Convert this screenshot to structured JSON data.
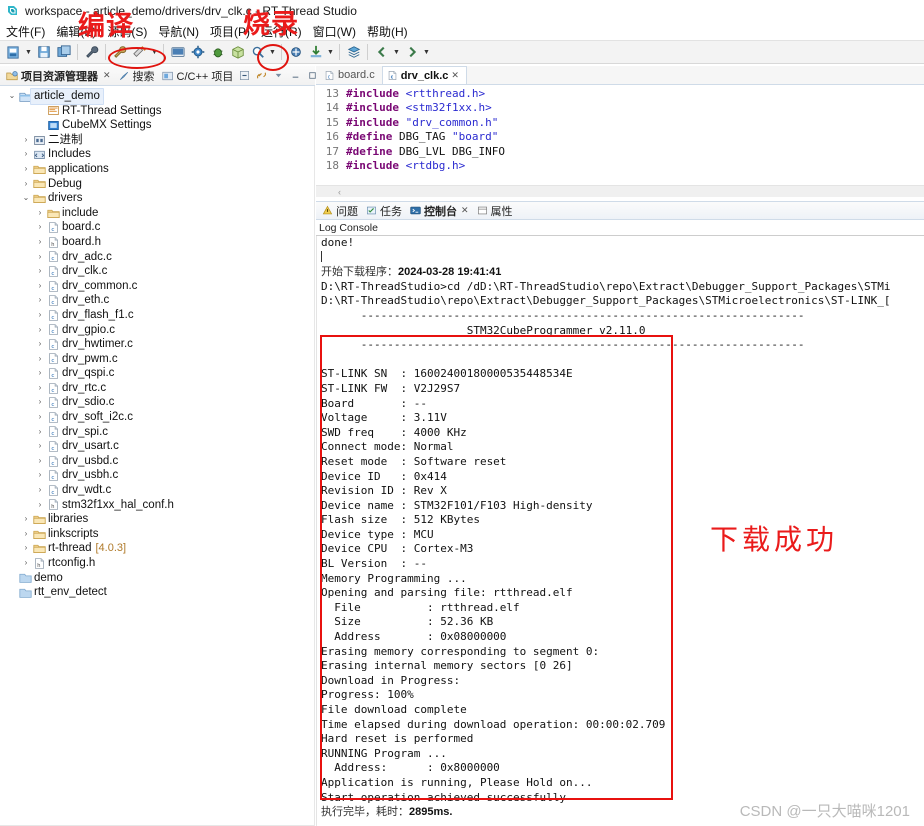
{
  "window": {
    "title": "workspace - article_demo/drivers/drv_clk.c - RT-Thread Studio",
    "app_icon": "rt-thread-logo-icon"
  },
  "menubar": {
    "items": [
      {
        "label": "文件(F)",
        "name": "menu-file"
      },
      {
        "label": "编辑(E)",
        "name": "menu-edit"
      },
      {
        "label": "源码(S)",
        "name": "menu-source"
      },
      {
        "label": "导航(N)",
        "name": "menu-navigate"
      },
      {
        "label": "项目(P)",
        "name": "menu-project"
      },
      {
        "label": "运行(R)",
        "name": "menu-run"
      },
      {
        "label": "窗口(W)",
        "name": "menu-window"
      },
      {
        "label": "帮助(H)",
        "name": "menu-help"
      }
    ]
  },
  "toolbar": {
    "buttons": [
      {
        "name": "new-icon",
        "glyph": "new"
      },
      {
        "name": "new-dropdown-arrow-icon",
        "glyph": "arrow"
      },
      {
        "name": "save-icon",
        "glyph": "save"
      },
      {
        "name": "save-all-icon",
        "glyph": "saveall"
      },
      {
        "name": "sep1",
        "glyph": "sep"
      },
      {
        "name": "wrench-icon",
        "glyph": "wrench"
      },
      {
        "name": "sep2",
        "glyph": "sep"
      },
      {
        "name": "build-icon",
        "glyph": "build"
      },
      {
        "name": "clean-icon",
        "glyph": "clean"
      },
      {
        "name": "build-dropdown-arrow-icon",
        "glyph": "arrow"
      },
      {
        "name": "sep3",
        "glyph": "sep"
      },
      {
        "name": "terminal-icon",
        "glyph": "terminal"
      },
      {
        "name": "settings-gear-icon",
        "glyph": "gear"
      },
      {
        "name": "debug-bug-icon",
        "glyph": "bug"
      },
      {
        "name": "package-icon",
        "glyph": "package"
      },
      {
        "name": "search-icon",
        "glyph": "search"
      },
      {
        "name": "search-dropdown-arrow-icon",
        "glyph": "arrow"
      },
      {
        "name": "sep4",
        "glyph": "sep"
      },
      {
        "name": "flash-icon",
        "glyph": "flash"
      },
      {
        "name": "download-icon",
        "glyph": "download"
      },
      {
        "name": "download-dropdown-arrow-icon",
        "glyph": "arrow"
      },
      {
        "name": "sep5",
        "glyph": "sep"
      },
      {
        "name": "layers-icon",
        "glyph": "layers"
      },
      {
        "name": "sep6",
        "glyph": "sep"
      },
      {
        "name": "back-icon",
        "glyph": "back"
      },
      {
        "name": "back-dropdown-arrow-icon",
        "glyph": "arrow"
      },
      {
        "name": "forward-icon",
        "glyph": "forward"
      },
      {
        "name": "forward-dropdown-arrow-icon",
        "glyph": "arrow"
      }
    ]
  },
  "annotations": {
    "compile": "编译",
    "flash": "烧录",
    "download_success": "下载成功",
    "box_color": "#e8110f",
    "text_color": "#ea1b1b"
  },
  "watermark": "CSDN @一只大喵咪1201",
  "left_panel": {
    "tabs": [
      {
        "label": "项目资源管理器",
        "name": "tab-project-explorer",
        "active": true,
        "icon": "project-explorer-icon",
        "closable": true
      },
      {
        "label": "搜索",
        "name": "tab-search",
        "active": false,
        "icon": "search-view-icon",
        "closable": false
      },
      {
        "label": "C/C++ 项目",
        "name": "tab-cpp-projects",
        "active": false,
        "icon": "cpp-projects-icon",
        "closable": false
      }
    ],
    "view_tools": [
      {
        "name": "collapse-all-icon"
      },
      {
        "name": "link-with-editor-icon"
      },
      {
        "name": "view-menu-icon"
      },
      {
        "name": "minimize-icon"
      },
      {
        "name": "maximize-icon"
      }
    ],
    "tree": [
      {
        "label": "article_demo",
        "indent": 0,
        "twist": "open",
        "icon": "project",
        "selected": true
      },
      {
        "label": "RT-Thread Settings",
        "indent": 2,
        "twist": "none",
        "icon": "rtt-settings"
      },
      {
        "label": "CubeMX Settings",
        "indent": 2,
        "twist": "none",
        "icon": "cubemx-settings"
      },
      {
        "label": "二进制",
        "indent": 1,
        "twist": "closed",
        "icon": "binaries"
      },
      {
        "label": "Includes",
        "indent": 1,
        "twist": "closed",
        "icon": "includes"
      },
      {
        "label": "applications",
        "indent": 1,
        "twist": "closed",
        "icon": "folder"
      },
      {
        "label": "Debug",
        "indent": 1,
        "twist": "closed",
        "icon": "folder"
      },
      {
        "label": "drivers",
        "indent": 1,
        "twist": "open",
        "icon": "folder"
      },
      {
        "label": "include",
        "indent": 2,
        "twist": "closed",
        "icon": "folder"
      },
      {
        "label": "board.c",
        "indent": 2,
        "twist": "closed",
        "icon": "c-file"
      },
      {
        "label": "board.h",
        "indent": 2,
        "twist": "closed",
        "icon": "h-file"
      },
      {
        "label": "drv_adc.c",
        "indent": 2,
        "twist": "closed",
        "icon": "c-file"
      },
      {
        "label": "drv_clk.c",
        "indent": 2,
        "twist": "closed",
        "icon": "c-file"
      },
      {
        "label": "drv_common.c",
        "indent": 2,
        "twist": "closed",
        "icon": "c-file"
      },
      {
        "label": "drv_eth.c",
        "indent": 2,
        "twist": "closed",
        "icon": "c-file"
      },
      {
        "label": "drv_flash_f1.c",
        "indent": 2,
        "twist": "closed",
        "icon": "c-file"
      },
      {
        "label": "drv_gpio.c",
        "indent": 2,
        "twist": "closed",
        "icon": "c-file"
      },
      {
        "label": "drv_hwtimer.c",
        "indent": 2,
        "twist": "closed",
        "icon": "c-file"
      },
      {
        "label": "drv_pwm.c",
        "indent": 2,
        "twist": "closed",
        "icon": "c-file"
      },
      {
        "label": "drv_qspi.c",
        "indent": 2,
        "twist": "closed",
        "icon": "c-file"
      },
      {
        "label": "drv_rtc.c",
        "indent": 2,
        "twist": "closed",
        "icon": "c-file"
      },
      {
        "label": "drv_sdio.c",
        "indent": 2,
        "twist": "closed",
        "icon": "c-file"
      },
      {
        "label": "drv_soft_i2c.c",
        "indent": 2,
        "twist": "closed",
        "icon": "c-file"
      },
      {
        "label": "drv_spi.c",
        "indent": 2,
        "twist": "closed",
        "icon": "c-file"
      },
      {
        "label": "drv_usart.c",
        "indent": 2,
        "twist": "closed",
        "icon": "c-file"
      },
      {
        "label": "drv_usbd.c",
        "indent": 2,
        "twist": "closed",
        "icon": "c-file"
      },
      {
        "label": "drv_usbh.c",
        "indent": 2,
        "twist": "closed",
        "icon": "c-file"
      },
      {
        "label": "drv_wdt.c",
        "indent": 2,
        "twist": "closed",
        "icon": "c-file"
      },
      {
        "label": "stm32f1xx_hal_conf.h",
        "indent": 2,
        "twist": "closed",
        "icon": "h-file"
      },
      {
        "label": "libraries",
        "indent": 1,
        "twist": "closed",
        "icon": "folder"
      },
      {
        "label": "linkscripts",
        "indent": 1,
        "twist": "closed",
        "icon": "folder"
      },
      {
        "label": "rt-thread",
        "indent": 1,
        "twist": "closed",
        "icon": "folder",
        "version": "[4.0.3]"
      },
      {
        "label": "rtconfig.h",
        "indent": 1,
        "twist": "closed",
        "icon": "h-file"
      },
      {
        "label": "demo",
        "indent": 0,
        "twist": "none",
        "icon": "closed-project"
      },
      {
        "label": "rtt_env_detect",
        "indent": 0,
        "twist": "none",
        "icon": "closed-project"
      }
    ]
  },
  "editor": {
    "tabs": [
      {
        "label": "board.c",
        "name": "editor-tab-board-c",
        "active": false,
        "icon": "c-file-icon",
        "closable": false
      },
      {
        "label": "drv_clk.c",
        "name": "editor-tab-drv-clk-c",
        "active": true,
        "icon": "c-file-icon",
        "closable": true
      }
    ],
    "lines": [
      {
        "no": "13",
        "parts": [
          {
            "t": "#include ",
            "c": "pre"
          },
          {
            "t": "<rtthread.h>",
            "c": "inc"
          }
        ]
      },
      {
        "no": "14",
        "parts": [
          {
            "t": "#include ",
            "c": "pre"
          },
          {
            "t": "<stm32f1xx.h>",
            "c": "inc"
          }
        ]
      },
      {
        "no": "15",
        "parts": [
          {
            "t": "#include ",
            "c": "pre"
          },
          {
            "t": "\"drv_common.h\"",
            "c": "str"
          }
        ]
      },
      {
        "no": "16",
        "parts": [
          {
            "t": "#define ",
            "c": "pre"
          },
          {
            "t": "DBG_TAG ",
            "c": "plain"
          },
          {
            "t": "\"board\"",
            "c": "str"
          }
        ]
      },
      {
        "no": "17",
        "parts": [
          {
            "t": "#define ",
            "c": "pre"
          },
          {
            "t": "DBG_LVL DBG_INFO",
            "c": "plain"
          }
        ]
      },
      {
        "no": "18",
        "parts": [
          {
            "t": "#include ",
            "c": "pre"
          },
          {
            "t": "<rtdbg.h>",
            "c": "inc"
          }
        ]
      }
    ],
    "hscroll_glyph": "‹"
  },
  "console": {
    "tabs": [
      {
        "label": "问题",
        "name": "tab-problems",
        "active": false,
        "icon": "problems-icon",
        "closable": false
      },
      {
        "label": "任务",
        "name": "tab-tasks",
        "active": false,
        "icon": "tasks-icon",
        "closable": false
      },
      {
        "label": "控制台",
        "name": "tab-console",
        "active": true,
        "icon": "console-icon",
        "closable": true
      },
      {
        "label": "属性",
        "name": "tab-properties",
        "active": false,
        "icon": "properties-icon",
        "closable": false
      }
    ],
    "title": "Log Console",
    "lines": [
      {
        "text": "done!",
        "style": "mono"
      },
      {
        "text": "",
        "style": "caret"
      },
      {
        "text": "开始下载程序：",
        "bold": "2024-03-28 19:41:41",
        "style": "ui"
      },
      {
        "text": "D:\\RT-ThreadStudio>cd /dD:\\RT-ThreadStudio\\repo\\Extract\\Debugger_Support_Packages\\STMi",
        "style": "mono"
      },
      {
        "text": "D:\\RT-ThreadStudio\\repo\\Extract\\Debugger_Support_Packages\\STMicroelectronics\\ST-LINK_[",
        "style": "mono"
      },
      {
        "text": "      -------------------------------------------------------------------",
        "style": "mono"
      },
      {
        "text": "                      STM32CubeProgrammer v2.11.0",
        "style": "mono"
      },
      {
        "text": "      -------------------------------------------------------------------",
        "style": "mono"
      },
      {
        "text": "",
        "style": "mono"
      },
      {
        "text": "ST-LINK SN  : 16002400180000535448534E",
        "style": "mono"
      },
      {
        "text": "ST-LINK FW  : V2J29S7",
        "style": "mono"
      },
      {
        "text": "Board       : --",
        "style": "mono"
      },
      {
        "text": "Voltage     : 3.11V",
        "style": "mono"
      },
      {
        "text": "SWD freq    : 4000 KHz",
        "style": "mono"
      },
      {
        "text": "Connect mode: Normal",
        "style": "mono"
      },
      {
        "text": "Reset mode  : Software reset",
        "style": "mono"
      },
      {
        "text": "Device ID   : 0x414",
        "style": "mono"
      },
      {
        "text": "Revision ID : Rev X",
        "style": "mono"
      },
      {
        "text": "Device name : STM32F101/F103 High-density",
        "style": "mono"
      },
      {
        "text": "Flash size  : 512 KBytes",
        "style": "mono"
      },
      {
        "text": "Device type : MCU",
        "style": "mono"
      },
      {
        "text": "Device CPU  : Cortex-M3",
        "style": "mono"
      },
      {
        "text": "BL Version  : --",
        "style": "mono"
      },
      {
        "text": "Memory Programming ...",
        "style": "mono"
      },
      {
        "text": "Opening and parsing file: rtthread.elf",
        "style": "mono"
      },
      {
        "text": "  File          : rtthread.elf",
        "style": "mono"
      },
      {
        "text": "  Size          : 52.36 KB",
        "style": "mono"
      },
      {
        "text": "  Address       : 0x08000000",
        "style": "mono"
      },
      {
        "text": "Erasing memory corresponding to segment 0:",
        "style": "mono"
      },
      {
        "text": "Erasing internal memory sectors [0 26]",
        "style": "mono"
      },
      {
        "text": "Download in Progress:",
        "style": "mono"
      },
      {
        "text": "Progress: 100%",
        "style": "mono"
      },
      {
        "text": "File download complete",
        "style": "mono"
      },
      {
        "text": "Time elapsed during download operation: 00:00:02.709",
        "style": "mono"
      },
      {
        "text": "Hard reset is performed",
        "style": "mono"
      },
      {
        "text": "RUNNING Program ...",
        "style": "mono"
      },
      {
        "text": "  Address:      : 0x8000000",
        "style": "mono"
      },
      {
        "text": "Application is running, Please Hold on...",
        "style": "mono"
      },
      {
        "text": "Start operation achieved successfully",
        "style": "mono"
      },
      {
        "text": "执行完毕，耗时：",
        "bold": "2895ms.",
        "style": "ui"
      }
    ]
  }
}
